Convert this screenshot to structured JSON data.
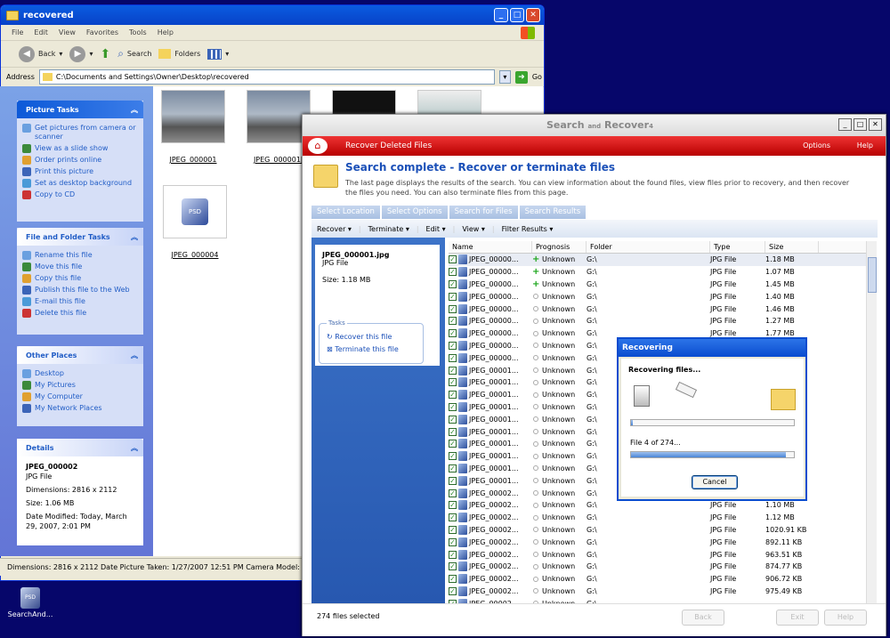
{
  "explorer": {
    "title": "recovered",
    "menu": [
      "File",
      "Edit",
      "View",
      "Favorites",
      "Tools",
      "Help"
    ],
    "toolbar": {
      "back": "Back",
      "search": "Search",
      "folders": "Folders"
    },
    "address_label": "Address",
    "address": "C:\\Documents and Settings\\Owner\\Desktop\\recovered",
    "go": "Go",
    "picture_tasks": {
      "title": "Picture Tasks",
      "items": [
        "Get pictures from camera or scanner",
        "View as a slide show",
        "Order prints online",
        "Print this picture",
        "Set as desktop background",
        "Copy to CD"
      ]
    },
    "file_tasks": {
      "title": "File and Folder Tasks",
      "items": [
        "Rename this file",
        "Move this file",
        "Copy this file",
        "Publish this file to the Web",
        "E-mail this file",
        "Delete this file"
      ]
    },
    "other_places": {
      "title": "Other Places",
      "items": [
        "Desktop",
        "My Pictures",
        "My Computer",
        "My Network Places"
      ]
    },
    "details": {
      "title": "Details",
      "name": "JPEG_000002",
      "type": "JPG File",
      "dimensions": "Dimensions: 2816 x 2112",
      "size": "Size: 1.06 MB",
      "modified": "Date Modified: Today, March 29, 2007, 2:01 PM"
    },
    "thumbnails": [
      "JPEG_000001",
      "JPEG_000001[",
      "JPEG_000004"
    ],
    "thumb_badge": "PSD",
    "status": "Dimensions: 2816 x 2112 Date Picture Taken: 1/27/2007 12:51 PM Camera Model: Canor"
  },
  "desktop_icon": {
    "label": "SearchAnd...",
    "badge": "PSD"
  },
  "sr": {
    "brand": "Search and Recover",
    "brand_and": "and",
    "brand_version": "4",
    "section": "Recover Deleted Files",
    "options": "Options",
    "help": "Help",
    "heading": "Search complete - Recover or terminate files",
    "description": "The last page displays the results of the search. You can view information about the found files, view files prior to recovery, and then recover the files you need. You can also terminate files from this page.",
    "tabs": [
      "Select Location",
      "Select Options",
      "Search for Files",
      "Search Results"
    ],
    "menu": [
      "Recover",
      "Terminate",
      "Edit",
      "View",
      "Filter Results"
    ],
    "file": {
      "name": "JPEG_000001.jpg",
      "type": "JPG File",
      "size": "Size: 1.18 MB"
    },
    "tasks_legend": "Tasks",
    "tasks": [
      "Recover this file",
      "Terminate this file"
    ],
    "columns": [
      "Name",
      "Prognosis",
      "Folder",
      "Type",
      "Size"
    ],
    "rows": [
      {
        "name": "JPEG_00000...",
        "prog": "Unknown",
        "ok": true,
        "folder": "G:\\",
        "type": "JPG File",
        "size": "1.18 MB"
      },
      {
        "name": "JPEG_00000...",
        "prog": "Unknown",
        "ok": true,
        "folder": "G:\\",
        "type": "JPG File",
        "size": "1.07 MB"
      },
      {
        "name": "JPEG_00000...",
        "prog": "Unknown",
        "ok": true,
        "folder": "G:\\",
        "type": "JPG File",
        "size": "1.45 MB"
      },
      {
        "name": "JPEG_00000...",
        "prog": "Unknown",
        "ok": false,
        "folder": "G:\\",
        "type": "JPG File",
        "size": "1.40 MB"
      },
      {
        "name": "JPEG_00000...",
        "prog": "Unknown",
        "ok": false,
        "folder": "G:\\",
        "type": "JPG File",
        "size": "1.46 MB"
      },
      {
        "name": "JPEG_00000...",
        "prog": "Unknown",
        "ok": false,
        "folder": "G:\\",
        "type": "JPG File",
        "size": "1.27 MB"
      },
      {
        "name": "JPEG_00000...",
        "prog": "Unknown",
        "ok": false,
        "folder": "G:\\",
        "type": "JPG File",
        "size": "1.77 MB"
      },
      {
        "name": "JPEG_00000...",
        "prog": "Unknown",
        "ok": false,
        "folder": "G:\\",
        "type": "",
        "size": ""
      },
      {
        "name": "JPEG_00000...",
        "prog": "Unknown",
        "ok": false,
        "folder": "G:\\",
        "type": "",
        "size": ""
      },
      {
        "name": "JPEG_00001...",
        "prog": "Unknown",
        "ok": false,
        "folder": "G:\\",
        "type": "",
        "size": ""
      },
      {
        "name": "JPEG_00001...",
        "prog": "Unknown",
        "ok": false,
        "folder": "G:\\",
        "type": "",
        "size": ""
      },
      {
        "name": "JPEG_00001...",
        "prog": "Unknown",
        "ok": false,
        "folder": "G:\\",
        "type": "",
        "size": ""
      },
      {
        "name": "JPEG_00001...",
        "prog": "Unknown",
        "ok": false,
        "folder": "G:\\",
        "type": "",
        "size": ""
      },
      {
        "name": "JPEG_00001...",
        "prog": "Unknown",
        "ok": false,
        "folder": "G:\\",
        "type": "",
        "size": ""
      },
      {
        "name": "JPEG_00001...",
        "prog": "Unknown",
        "ok": false,
        "folder": "G:\\",
        "type": "",
        "size": ""
      },
      {
        "name": "JPEG_00001...",
        "prog": "Unknown",
        "ok": false,
        "folder": "G:\\",
        "type": "",
        "size": ""
      },
      {
        "name": "JPEG_00001...",
        "prog": "Unknown",
        "ok": false,
        "folder": "G:\\",
        "type": "",
        "size": ""
      },
      {
        "name": "JPEG_00001...",
        "prog": "Unknown",
        "ok": false,
        "folder": "G:\\",
        "type": "",
        "size": ""
      },
      {
        "name": "JPEG_00001...",
        "prog": "Unknown",
        "ok": false,
        "folder": "G:\\",
        "type": "",
        "size": ""
      },
      {
        "name": "JPEG_00002...",
        "prog": "Unknown",
        "ok": false,
        "folder": "G:\\",
        "type": "",
        "size": ""
      },
      {
        "name": "JPEG_00002...",
        "prog": "Unknown",
        "ok": false,
        "folder": "G:\\",
        "type": "JPG File",
        "size": "1.10 MB"
      },
      {
        "name": "JPEG_00002...",
        "prog": "Unknown",
        "ok": false,
        "folder": "G:\\",
        "type": "JPG File",
        "size": "1.12 MB"
      },
      {
        "name": "JPEG_00002...",
        "prog": "Unknown",
        "ok": false,
        "folder": "G:\\",
        "type": "JPG File",
        "size": "1020.91 KB"
      },
      {
        "name": "JPEG_00002...",
        "prog": "Unknown",
        "ok": false,
        "folder": "G:\\",
        "type": "JPG File",
        "size": "892.11 KB"
      },
      {
        "name": "JPEG_00002...",
        "prog": "Unknown",
        "ok": false,
        "folder": "G:\\",
        "type": "JPG File",
        "size": "963.51 KB"
      },
      {
        "name": "JPEG_00002...",
        "prog": "Unknown",
        "ok": false,
        "folder": "G:\\",
        "type": "JPG File",
        "size": "874.77 KB"
      },
      {
        "name": "JPEG_00002...",
        "prog": "Unknown",
        "ok": false,
        "folder": "G:\\",
        "type": "JPG File",
        "size": "906.72 KB"
      },
      {
        "name": "JPEG_00002...",
        "prog": "Unknown",
        "ok": false,
        "folder": "G:\\",
        "type": "JPG File",
        "size": "975.49 KB"
      },
      {
        "name": "JPEG_00002...",
        "prog": "Unknown",
        "ok": false,
        "folder": "G:\\",
        "type": "",
        "size": ""
      }
    ],
    "selected_count": "274 files selected",
    "buttons": {
      "back": "Back",
      "exit": "Exit",
      "help": "Help"
    }
  },
  "dialog": {
    "title": "Recovering",
    "heading": "Recovering files...",
    "progress_label": "File 4 of 274...",
    "progress_top": 0.01,
    "progress_bottom": 0.95,
    "cancel": "Cancel"
  }
}
